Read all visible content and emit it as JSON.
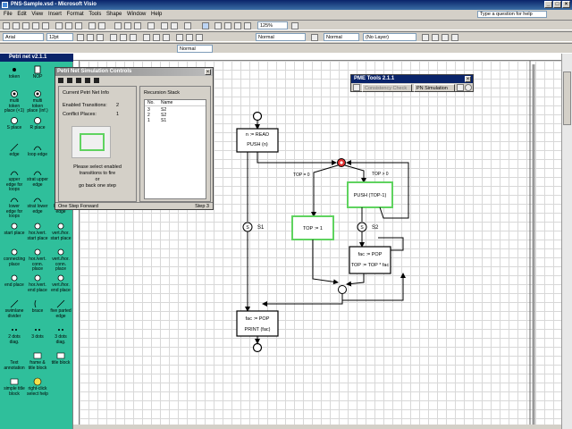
{
  "window": {
    "title": "PNS-Sample.vsd - Microsoft Visio"
  },
  "menu": [
    "File",
    "Edit",
    "View",
    "Insert",
    "Format",
    "Tools",
    "Shape",
    "Window",
    "Help"
  ],
  "help_box": {
    "placeholder": "Type a question for help"
  },
  "toolbar": {
    "zoom": "125%",
    "font": "Arial",
    "size": "12pt",
    "style": "Normal",
    "line_style": "Normal",
    "text_style": "Normal",
    "layer": "(No Layer)"
  },
  "stencil": {
    "title": "Petri net v2.1.1",
    "items": [
      {
        "label": "token"
      },
      {
        "label": "NOP"
      },
      {
        "label": "multi token place (<1)"
      },
      {
        "label": "multi token place (inf.)"
      },
      {
        "label": "S place"
      },
      {
        "label": "R place"
      },
      {
        "label": "edge"
      },
      {
        "label": "loop edge"
      },
      {
        "label": "upper edge for loops"
      },
      {
        "label": "strat upper edge"
      },
      {
        "label": "lower edge for loops"
      },
      {
        "label": "strat lower edge"
      },
      {
        "label": "hor. LS edge"
      },
      {
        "label": "start place"
      },
      {
        "label": "hor./vert. start place"
      },
      {
        "label": "vert./hor. start place"
      },
      {
        "label": "connecting place"
      },
      {
        "label": "hor./vert. conn. place"
      },
      {
        "label": "vert./hor. conn. place"
      },
      {
        "label": "end place"
      },
      {
        "label": "hor./vert. end place"
      },
      {
        "label": "vert./hor. end place"
      },
      {
        "label": "swimlane divider"
      },
      {
        "label": "brace"
      },
      {
        "label": "five parted edge"
      },
      {
        "label": "2 dots diag."
      },
      {
        "label": "3 dots"
      },
      {
        "label": "3 dots diag."
      },
      {
        "label": "Text annotation"
      },
      {
        "label": "frame & title block"
      },
      {
        "label": "title block"
      },
      {
        "label": "simple title block"
      },
      {
        "label": "right-click select help"
      }
    ]
  },
  "sim_panel": {
    "title": "Petri Net Simulation Controls",
    "info_heading": "Current Petri Net Info",
    "enabled_label": "Enabled Transitions:",
    "enabled_value": "2",
    "conflict_label": "Conflict Places:",
    "conflict_value": "1",
    "recursion_heading": "Recursion Stack",
    "stack_headers": [
      "No.",
      "Name"
    ],
    "stack_rows": [
      [
        "3",
        "S2"
      ],
      [
        "2",
        "S2"
      ],
      [
        "1",
        "S1"
      ]
    ],
    "message_line1": "Please select enabled",
    "message_line2": "transitions to fire",
    "message_line3": "or",
    "message_line4": "go back one step",
    "status_left": "One Step Forward",
    "status_right": "Step 3"
  },
  "pmtools": {
    "title": "PME Tools 2.1.1",
    "consistency": "Consistency Check",
    "simulation": "PN Simulation"
  },
  "diagram": {
    "t1_line1": "n := READ",
    "t1_line2": "PUSH (n)",
    "guard_left": "TOP = 0",
    "guard_right": "TOP > 0",
    "t_push": "PUSH (TOP-1)",
    "t_top": "TOP := 1",
    "s1": "S1",
    "s2": "S2",
    "s_letter": "S",
    "t_fac1": "fac := POP",
    "t_fac2": "TOP := TOP * fac",
    "t_end1": "fac := POP",
    "t_end2": "PRINT (fac)"
  },
  "colors": {
    "stencil_bg": "#2fbf9b",
    "enabled_green": "#5fd35f",
    "conflict_red": "#e03030",
    "title_blue": "#0a246a"
  }
}
